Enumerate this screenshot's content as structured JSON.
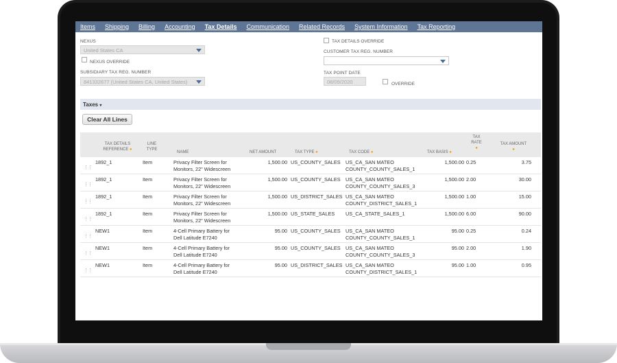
{
  "tabs": [
    {
      "label": "Items",
      "active": false
    },
    {
      "label": "Shipping",
      "active": false
    },
    {
      "label": "Billing",
      "active": false
    },
    {
      "label": "Accounting",
      "active": false
    },
    {
      "label": "Tax Details",
      "active": true
    },
    {
      "label": "Communication",
      "active": false
    },
    {
      "label": "Related Records",
      "active": false
    },
    {
      "label": "System Information",
      "active": false
    },
    {
      "label": "Tax Reporting",
      "active": false
    }
  ],
  "form": {
    "nexus_label": "NEXUS",
    "nexus_value": "United States CA",
    "nexus_override_label": "NEXUS OVERRIDE",
    "subsidiary_label": "SUBSIDIARY TAX REG. NUMBER",
    "subsidiary_value": "841332677 (United States CA, United States)",
    "tax_details_override_label": "TAX DETAILS OVERRIDE",
    "customer_tax_label": "CUSTOMER TAX REG. NUMBER",
    "customer_tax_value": "",
    "tax_point_label": "TAX POINT DATE",
    "tax_point_value": "08/09/2020",
    "override_label": "OVERRIDE"
  },
  "section": {
    "title": "Taxes",
    "clear_button": "Clear All Lines"
  },
  "table": {
    "headers": {
      "ref": "TAX DETAILS REFERENCE",
      "line_type": "LINE TYPE",
      "name": "NAME",
      "net_amount": "NET AMOUNT",
      "tax_type": "TAX TYPE",
      "tax_code": "TAX CODE",
      "tax_basis": "TAX BASIS",
      "tax_rate": "TAX RATE",
      "tax_amount": "TAX AMOUNT"
    },
    "rows": [
      {
        "ref": "1892_1",
        "line_type": "Item",
        "name1": "Privacy Filter Screen for",
        "name2": "Monitors, 22\" Widescreen",
        "net": "1,500.00",
        "tax_type": "US_COUNTY_SALES",
        "code1": "US_CA_SAN MATEO",
        "code2": "COUNTY_COUNTY_SALES_1",
        "basis": "1,500.00",
        "rate": "0.25",
        "amount": "3.75"
      },
      {
        "ref": "1892_1",
        "line_type": "Item",
        "name1": "Privacy Filter Screen for",
        "name2": "Monitors, 22\" Widescreen",
        "net": "1,500.00",
        "tax_type": "US_COUNTY_SALES",
        "code1": "US_CA_SAN MATEO",
        "code2": "COUNTY_COUNTY_SALES_3",
        "basis": "1,500.00",
        "rate": "2.00",
        "amount": "30.00"
      },
      {
        "ref": "1892_1",
        "line_type": "Item",
        "name1": "Privacy Filter Screen for",
        "name2": "Monitors, 22\" Widescreen",
        "net": "1,500.00",
        "tax_type": "US_DISTRICT_SALES",
        "code1": "US_CA_SAN MATEO",
        "code2": "COUNTY_DISTRICT_SALES_1",
        "basis": "1,500.00",
        "rate": "1.00",
        "amount": "15.00"
      },
      {
        "ref": "1892_1",
        "line_type": "Item",
        "name1": "Privacy Filter Screen for",
        "name2": "Monitors, 22\" Widescreen",
        "net": "1,500.00",
        "tax_type": "US_STATE_SALES",
        "code1": "US_CA_STATE_SALES_1",
        "code2": "",
        "basis": "1,500.00",
        "rate": "6.00",
        "amount": "90.00"
      },
      {
        "ref": "NEW1",
        "line_type": "Item",
        "name1": "4-Cell Primary Battery for",
        "name2": "Dell Latitude E7240",
        "net": "95.00",
        "tax_type": "US_COUNTY_SALES",
        "code1": "US_CA_SAN MATEO",
        "code2": "COUNTY_COUNTY_SALES_1",
        "basis": "95.00",
        "rate": "0.25",
        "amount": "0.24"
      },
      {
        "ref": "NEW1",
        "line_type": "Item",
        "name1": "4-Cell Primary Battery for",
        "name2": "Dell Latitude E7240",
        "net": "95.00",
        "tax_type": "US_COUNTY_SALES",
        "code1": "US_CA_SAN MATEO",
        "code2": "COUNTY_COUNTY_SALES_3",
        "basis": "95.00",
        "rate": "2.00",
        "amount": "1.90"
      },
      {
        "ref": "NEW1",
        "line_type": "Item",
        "name1": "4-Cell Primary Battery for",
        "name2": "Dell Latitude E7240",
        "net": "95.00",
        "tax_type": "US_DISTRICT_SALES",
        "code1": "US_CA_SAN MATEO",
        "code2": "COUNTY_DISTRICT_SALES_1",
        "basis": "95.00",
        "rate": "1.00",
        "amount": "0.95"
      }
    ]
  }
}
